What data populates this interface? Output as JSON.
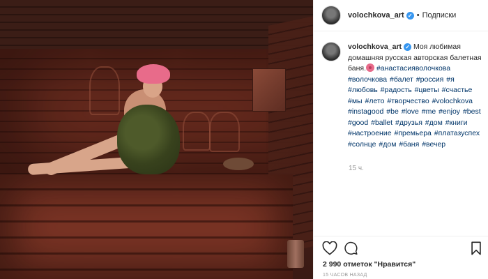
{
  "post": {
    "username": "volochkova_art",
    "separator": "•",
    "follow_label": "Подписки",
    "caption_text": "Моя любимая домашняя русская авторская балетная баня.",
    "hashtags": "#анастасияволочкова #волочкова #балет #россия #я #любовь #радость #цветы #счастье #мы #лето #творчество #volochkova #instagood #be #love #me #enjoy #best #good #ballet #друзья #дом #книги #настроение #премьера #платазуспех #солнце #дом #баня #вечер",
    "time_ago": "15 ч.",
    "likes_label": "2 990 отметок \"Нравится\"",
    "posted_ago": "15 ЧАСОВ НАЗАД",
    "verified_mark": "✓"
  },
  "colors": {
    "hashtag": "#003569",
    "verified": "#3897f0",
    "meta": "#999999"
  },
  "icons": {
    "like": "heart-icon",
    "comment": "comment-icon",
    "save": "bookmark-icon"
  }
}
